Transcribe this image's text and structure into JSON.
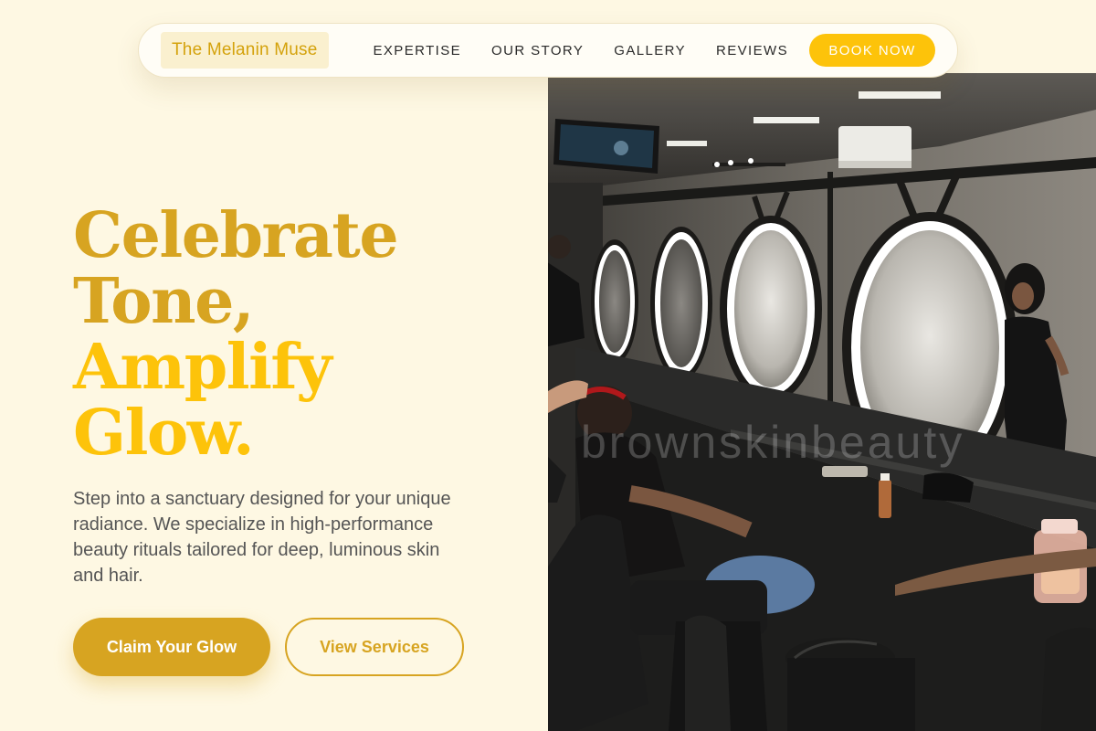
{
  "nav": {
    "brand": "The Melanin Muse",
    "links": [
      "EXPERTISE",
      "OUR STORY",
      "GALLERY",
      "REVIEWS"
    ],
    "cta": "BOOK NOW"
  },
  "hero": {
    "headline_line1": "Celebrate",
    "headline_line2": "Tone,",
    "headline_line3": "Amplify",
    "headline_line4": "Glow.",
    "description": "Step into a sanctuary designed for your unique radiance. We specialize in high-performance beauty rituals tailored for deep, luminous skin and hair.",
    "primary_cta": "Claim Your Glow",
    "secondary_cta": "View Services",
    "photo_watermark": "brownskinbeauty"
  },
  "colors": {
    "background": "#fef8e3",
    "brand_gold": "#d7a421",
    "accent_yellow": "#fdc30a",
    "text_body": "#555555",
    "nav_text": "#2b2b2b"
  },
  "icons": {
    "hero_image": "salon-interior-photo"
  }
}
